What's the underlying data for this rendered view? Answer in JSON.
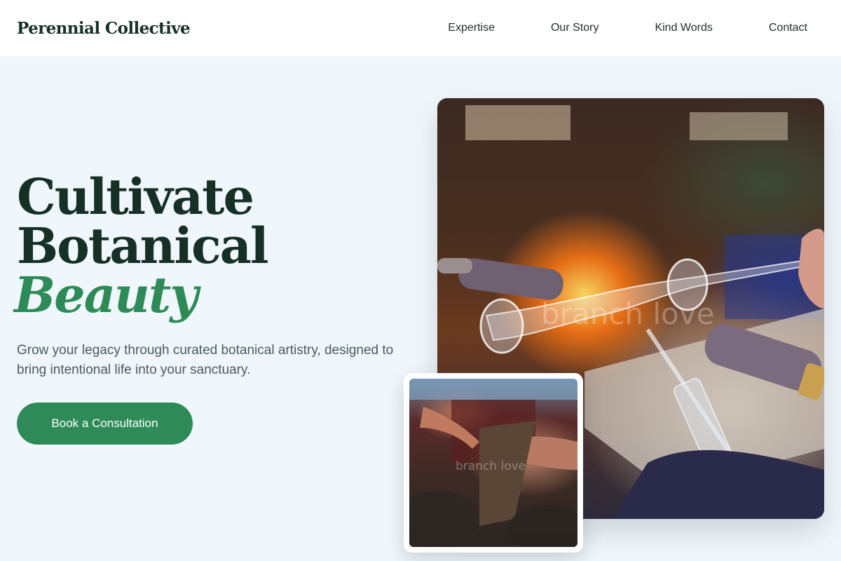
{
  "header": {
    "brand": "Perennial Collective",
    "nav": [
      "Expertise",
      "Our Story",
      "Kind Words",
      "Contact"
    ]
  },
  "hero": {
    "title_line1": "Cultivate",
    "title_line2": "Botanical",
    "title_accent": "Beauty",
    "subtitle": "Grow your legacy through curated botanical artistry, designed to bring intentional life into your sanctuary.",
    "cta_label": "Book a Consultation"
  },
  "images": {
    "main_watermark": "branch love",
    "inset_watermark": "branch love"
  },
  "colors": {
    "accent": "#2e8b57",
    "heading": "#163026",
    "background": "#f0f7fc"
  }
}
